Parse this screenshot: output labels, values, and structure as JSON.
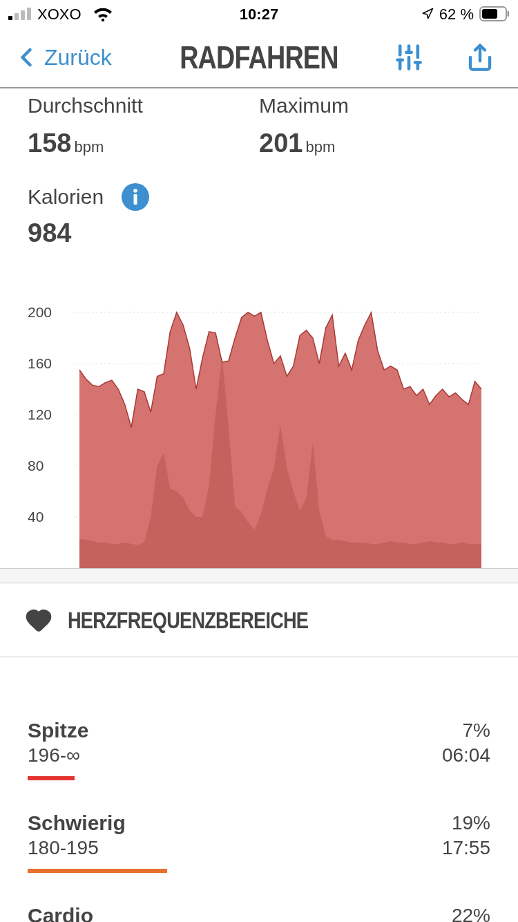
{
  "status_bar": {
    "carrier": "XOXO",
    "time": "10:27",
    "battery": "62 %"
  },
  "nav": {
    "back": "Zurück",
    "title": "RADFAHREN"
  },
  "stats": [
    {
      "label": "Durchschnitt",
      "value": "158",
      "unit": "bpm"
    },
    {
      "label": "Maximum",
      "value": "201",
      "unit": "bpm"
    }
  ],
  "calories": {
    "label": "Kalorien",
    "value": "984"
  },
  "chart_data": {
    "type": "area",
    "grid": true,
    "stacked": false,
    "ylim": [
      0,
      200
    ],
    "yticks": [
      40,
      80,
      120,
      160,
      200
    ],
    "series": [
      {
        "color": "#d4736f",
        "values": [
          155,
          148,
          143,
          142,
          145,
          147,
          140,
          128,
          110,
          140,
          138,
          122,
          150,
          152,
          185,
          200,
          190,
          172,
          140,
          165,
          185,
          184,
          161,
          162,
          180,
          196,
          200,
          197,
          200,
          178,
          160,
          166,
          150,
          158,
          182,
          186,
          180,
          160,
          188,
          198,
          158,
          168,
          155,
          178,
          190,
          200,
          170,
          155,
          158,
          155,
          140,
          142,
          135,
          140,
          128,
          135,
          140,
          134,
          137,
          132,
          128,
          146,
          140
        ]
      },
      {
        "color": "#c4625e",
        "values": [
          23,
          22,
          21,
          20,
          20,
          19,
          19,
          20,
          19,
          18,
          20,
          40,
          80,
          90,
          62,
          60,
          55,
          45,
          40,
          40,
          65,
          120,
          165,
          110,
          48,
          44,
          36,
          30,
          42,
          62,
          78,
          112,
          78,
          60,
          45,
          55,
          98,
          45,
          25,
          22,
          22,
          21,
          20,
          20,
          20,
          19,
          19,
          20,
          21,
          20,
          20,
          19,
          19,
          20,
          21,
          20,
          20,
          19,
          19,
          20,
          19,
          19,
          19
        ]
      }
    ]
  },
  "zones_section": {
    "title": "HERZFREQUENZBEREICHE"
  },
  "zones": [
    {
      "name": "Spitze",
      "range": "196-∞",
      "percent": "7%",
      "time": "06:04",
      "color": "#e3342f"
    },
    {
      "name": "Schwierig",
      "range": "180-195",
      "percent": "19%",
      "time": "17:55",
      "color": "#e8702f"
    },
    {
      "name": "Cardio",
      "percent": "22%"
    }
  ]
}
